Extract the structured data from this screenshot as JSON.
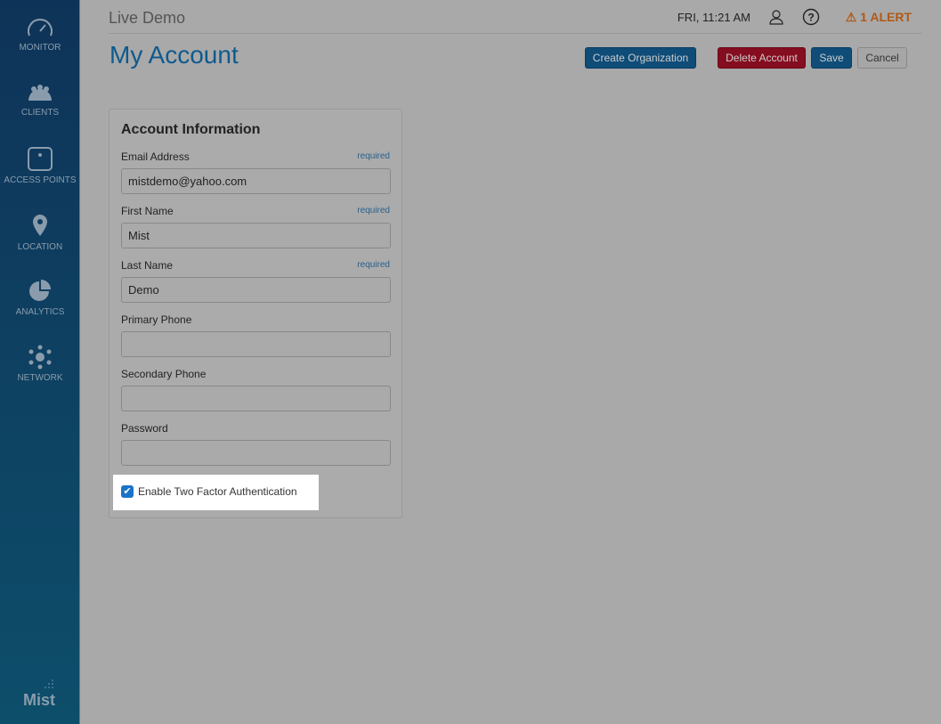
{
  "sidebar": {
    "items": [
      {
        "label": "MONITOR"
      },
      {
        "label": "CLIENTS"
      },
      {
        "label": "ACCESS POINTS"
      },
      {
        "label": "LOCATION"
      },
      {
        "label": "ANALYTICS"
      },
      {
        "label": "NETWORK"
      }
    ],
    "logo": "Mist"
  },
  "header": {
    "title": "Live Demo",
    "time": "FRI, 11:21 AM",
    "alert": "1 ALERT"
  },
  "page": {
    "title": "My Account",
    "buttons": {
      "create_org": "Create Organization",
      "delete": "Delete Account",
      "save": "Save",
      "cancel": "Cancel"
    }
  },
  "form": {
    "title": "Account Information",
    "required": "required",
    "fields": [
      {
        "label": "Email Address",
        "value": "mistdemo@yahoo.com"
      },
      {
        "label": "First Name",
        "value": "Mist"
      },
      {
        "label": "Last Name",
        "value": "Demo"
      },
      {
        "label": "Primary Phone",
        "value": ""
      },
      {
        "label": "Secondary Phone",
        "value": ""
      },
      {
        "label": "Password",
        "value": ""
      }
    ],
    "two_factor": {
      "label": "Enable Two Factor Authentication",
      "checked": true
    }
  },
  "colors": {
    "primary": "#0e5a8e",
    "danger": "#8a0e22",
    "alert": "#b05a18"
  }
}
